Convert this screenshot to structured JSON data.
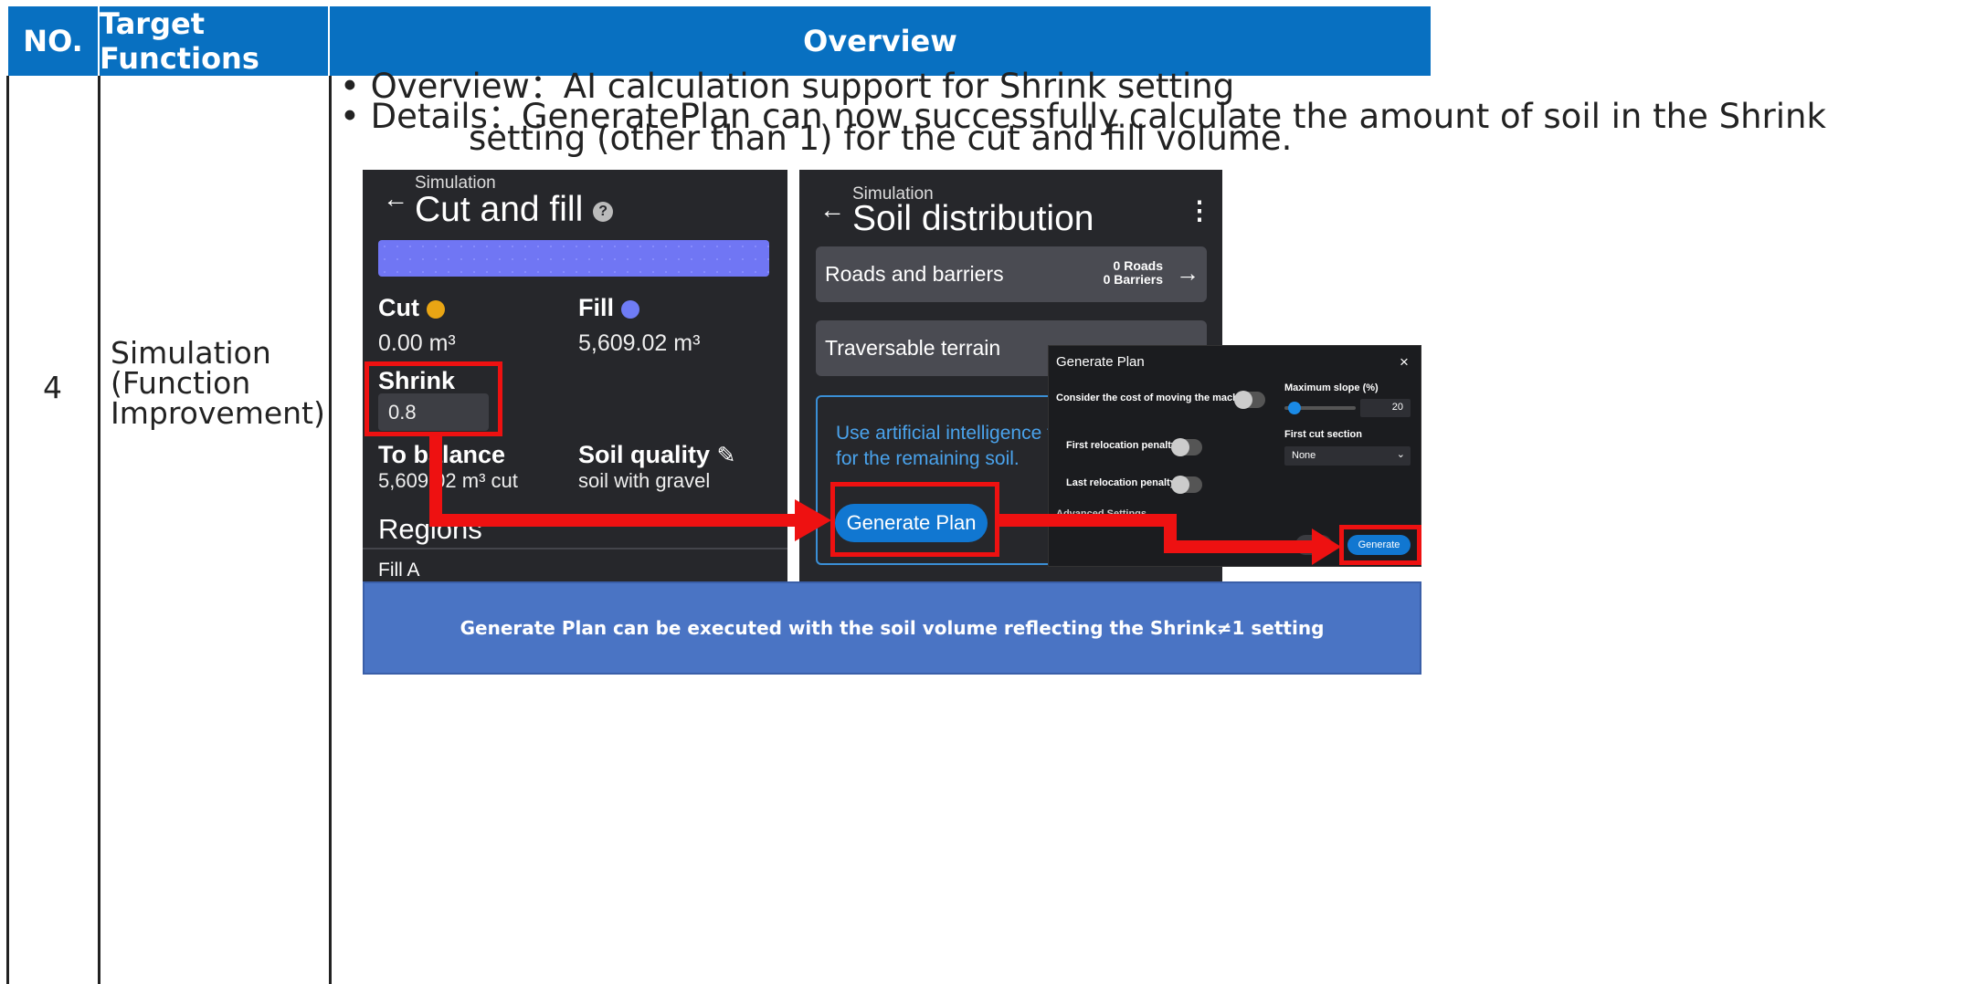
{
  "table": {
    "headers": {
      "no": "NO.",
      "functions": "Target Functions",
      "overview": "Overview"
    },
    "row": {
      "no": "4",
      "function_lines": [
        "Simulation",
        "(Function",
        "Improvement)"
      ],
      "overview_line": "• Overview：AI calculation support for Shrink setting",
      "details_line1": "• Details：GeneratePlan can now successfully calculate the amount of soil in the Shrink",
      "details_line2": "setting (other than 1) for the cut and fill volume."
    }
  },
  "left_panel": {
    "breadcrumb": "Simulation",
    "title": "Cut and fill",
    "cut_label": "Cut",
    "fill_label": "Fill",
    "cut_value": "0.00 m³",
    "fill_value": "5,609.02 m³",
    "shrink_label": "Shrink",
    "shrink_value": "0.8",
    "balance_label": "To balance",
    "balance_value": "5,609.02 m³ cut",
    "soil_quality_label": "Soil quality",
    "soil_quality_value": "soil with gravel",
    "regions_label": "Regions",
    "region_item": "Fill A",
    "colors": {
      "cut": "#e9a514",
      "fill": "#6f7cf5",
      "bar": "#7076f4"
    }
  },
  "right_panel": {
    "breadcrumb": "Simulation",
    "title": "Soil distribution",
    "roads_label": "Roads and barriers",
    "roads_count": "0 Roads",
    "barriers_count": "0 Barriers",
    "terrain_label": "Traversable terrain",
    "ai_text_line1": "Use artificial intelligence to",
    "ai_text_line2": "for the remaining soil.",
    "generate_plan_button": "Generate Plan"
  },
  "dialog": {
    "title": "Generate Plan",
    "close": "×",
    "consider_cost": "Consider the cost of moving the machine",
    "first_penalty": "First relocation penalty",
    "last_penalty": "Last relocation penalty",
    "advanced": "Advanced Settings",
    "max_slope_label": "Maximum slope (%)",
    "max_slope_value": "20",
    "first_cut_label": "First cut section",
    "first_cut_value": "None",
    "generate_button": "Generate"
  },
  "caption": "Generate Plan can be executed with the soil volume reflecting the Shrink≠1 setting"
}
